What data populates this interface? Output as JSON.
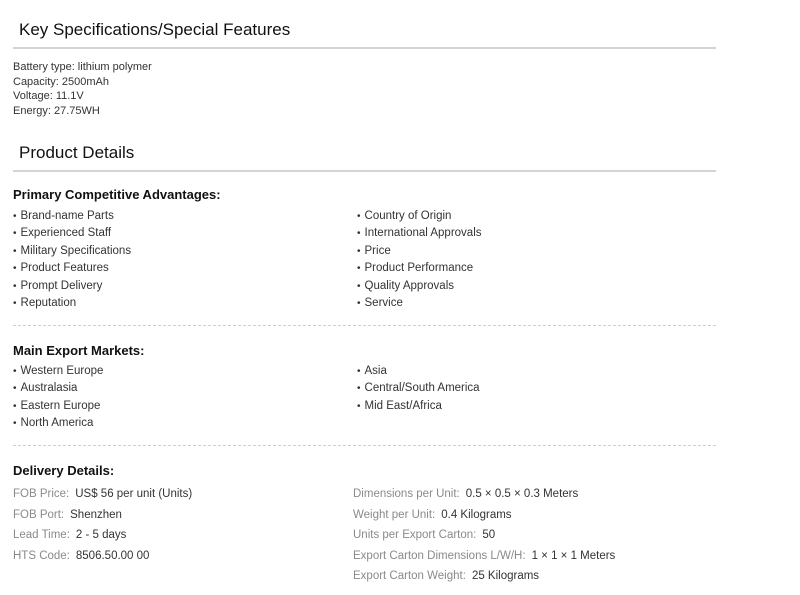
{
  "key_specs": {
    "title": "Key Specifications/Special Features",
    "lines": [
      "Battery type: lithium polymer",
      "Capacity: 2500mAh",
      "Voltage: 11.1V",
      "Energy: 27.75WH"
    ]
  },
  "product_details": {
    "title": "Product Details",
    "advantages": {
      "title": "Primary Competitive Advantages:",
      "left": [
        "Brand-name Parts",
        "Experienced Staff",
        "Military Specifications",
        "Product Features",
        "Prompt Delivery",
        "Reputation"
      ],
      "right": [
        "Country of Origin",
        "International Approvals",
        "Price",
        "Product Performance",
        "Quality Approvals",
        "Service"
      ]
    },
    "markets": {
      "title": "Main Export Markets:",
      "left": [
        "Western Europe",
        "Australasia",
        "Eastern Europe",
        "North America"
      ],
      "right": [
        "Asia",
        "Central/South America",
        "Mid East/Africa"
      ]
    },
    "delivery": {
      "title": "Delivery Details:",
      "left": [
        {
          "label": "FOB Price:",
          "value": "US$ 56 per unit (Units)"
        },
        {
          "label": "FOB Port:",
          "value": "Shenzhen"
        },
        {
          "label": "Lead Time:",
          "value": "2 - 5 days"
        },
        {
          "label": "HTS Code:",
          "value": "8506.50.00 00"
        }
      ],
      "right": [
        {
          "label": "Dimensions per Unit:",
          "value": "0.5 × 0.5 × 0.3 Meters"
        },
        {
          "label": "Weight per Unit:",
          "value": "0.4 Kilograms"
        },
        {
          "label": "Units per Export Carton:",
          "value": "50"
        },
        {
          "label": "Export Carton Dimensions L/W/H:",
          "value": "1 × 1 × 1 Meters"
        },
        {
          "label": "Export Carton Weight:",
          "value": "25 Kilograms"
        }
      ]
    }
  }
}
